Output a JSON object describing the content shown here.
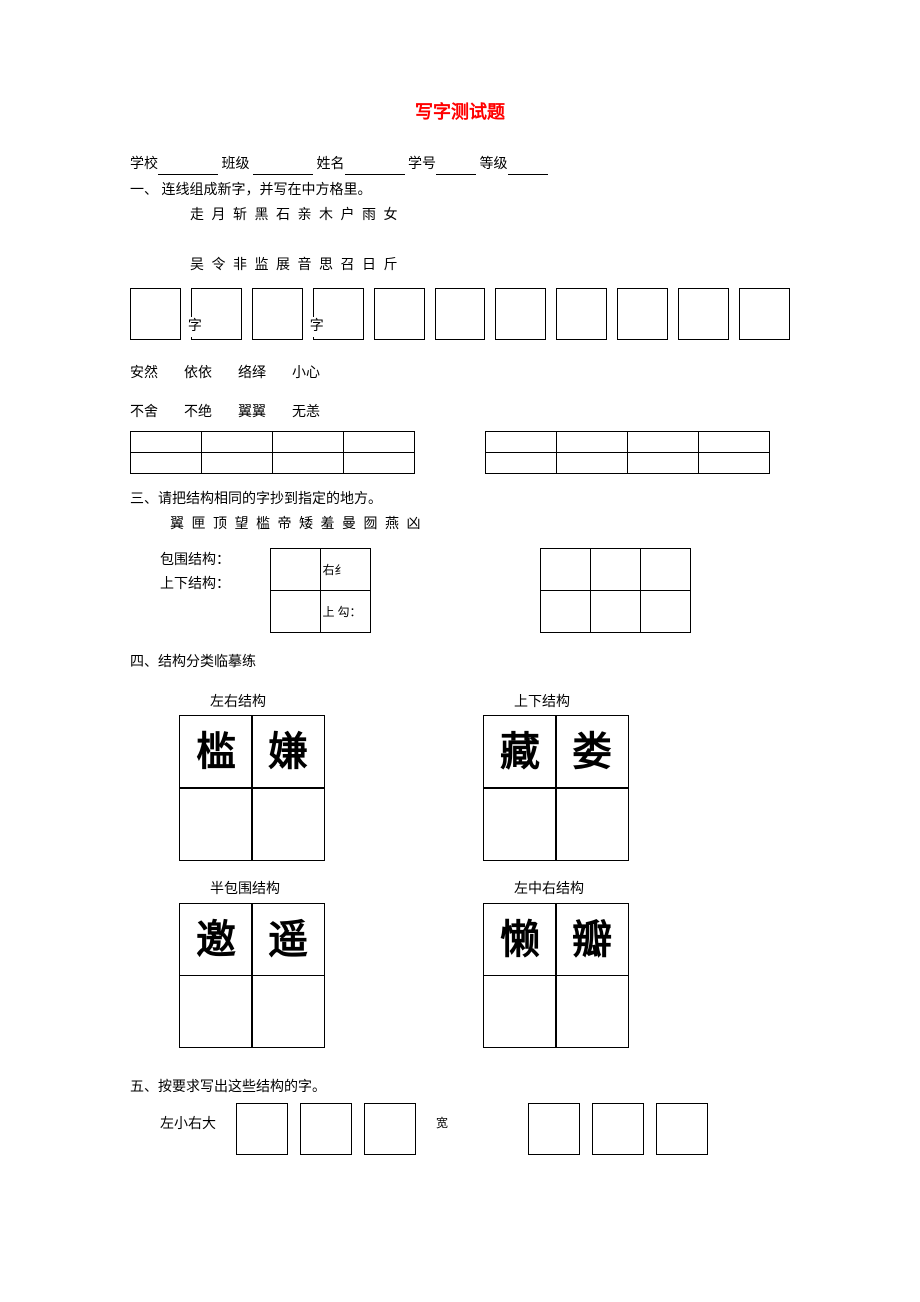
{
  "title": "写字测试题",
  "info": {
    "school": "学校",
    "class": "班级",
    "name": "姓名",
    "id": "学号",
    "grade": "等级"
  },
  "q1": {
    "heading": "一、    连线组成新字，并写在中方格里。",
    "row1": "走       月       斩     黑       石       亲        木       户        雨      女",
    "row2": "吴      令      非      监        展       音       思       召   日   斤",
    "mid1": "字",
    "mid2": "字"
  },
  "q2": {
    "row1": [
      "安然",
      "依依",
      "络绎",
      "小心"
    ],
    "row2": [
      "不舍",
      "不绝",
      "翼翼",
      "无恙"
    ]
  },
  "q3": {
    "heading": "三、请把结构相同的字抄到指定的地方。",
    "chars": "翼 匣 顶 望 槛 帝 矮 羞 曼 囫 燕 凶",
    "label1": "包围结构：",
    "label2": "上下结构：",
    "cell1": "右纟",
    "cell2": "上    勾："
  },
  "q4": {
    "heading": "四、结构分类临摹练",
    "blocks": [
      {
        "label": "左右结构",
        "chars": [
          "槛",
          "嫌"
        ]
      },
      {
        "label": "上下结构",
        "chars": [
          "藏",
          "娄"
        ]
      },
      {
        "label": "半包围结构",
        "chars": [
          "邀",
          "遥"
        ]
      },
      {
        "label": "左中右结构",
        "chars": [
          "懒",
          "瓣"
        ]
      }
    ]
  },
  "q5": {
    "heading": "五、按要求写出这些结构的字。",
    "label": "左小右大",
    "hidden": "宽"
  }
}
